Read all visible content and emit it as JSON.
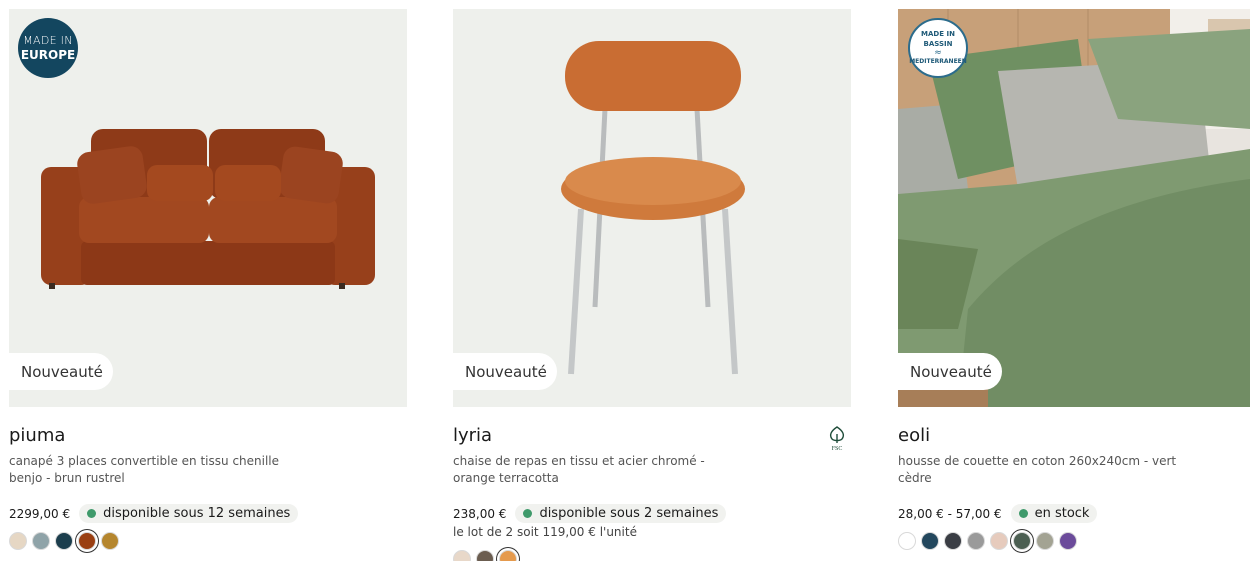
{
  "products": [
    {
      "badge_new": "Nouveauté",
      "made_badge": {
        "line1": "MADE IN",
        "line2": "EUROPE"
      },
      "image_icon": "sofa-image",
      "name": "piuma",
      "description": "canapé 3 places convertible en tissu chenille benjo - brun rustrel",
      "price": "2299,00 €",
      "availability": "disponible sous 12 semaines",
      "swatches": [
        "#e6d7c4",
        "#8fa3a8",
        "#1c3e4d",
        "#9a3f12",
        "#b5862e"
      ],
      "selected_swatch": 3
    },
    {
      "badge_new": "Nouveauté",
      "image_icon": "chair-image",
      "name": "lyria",
      "description": "chaise de repas en tissu et acier chromé - orange terracotta",
      "price": "238,00 €",
      "availability": "disponible sous 2 semaines",
      "unit_note": "le lot de 2 soit 119,00 € l'unité",
      "certification_icon": "fsc-tree-icon",
      "swatches": [
        "#e8d8c9",
        "#6b5d50",
        "#e59a4d"
      ],
      "selected_swatch": 2
    },
    {
      "badge_new": "Nouveauté",
      "made_badge": {
        "line1": "MADE IN",
        "line2": "BASSIN",
        "line3": "MEDITERRANEEN"
      },
      "image_icon": "bedding-image",
      "name": "eoli",
      "description": "housse de couette en coton 260x240cm - vert cèdre",
      "price": "28,00 € - 57,00 €",
      "availability": "en stock",
      "swatches": [
        "#ffffff",
        "#23475d",
        "#3a3d44",
        "#9a9a9a",
        "#e6cbbd",
        "#4c5f52",
        "#a3a393",
        "#6b4b9a"
      ],
      "selected_swatch": 5
    }
  ],
  "colors": {
    "stock_dot": "#3f9a6b",
    "badge_dark": "#13465f"
  }
}
